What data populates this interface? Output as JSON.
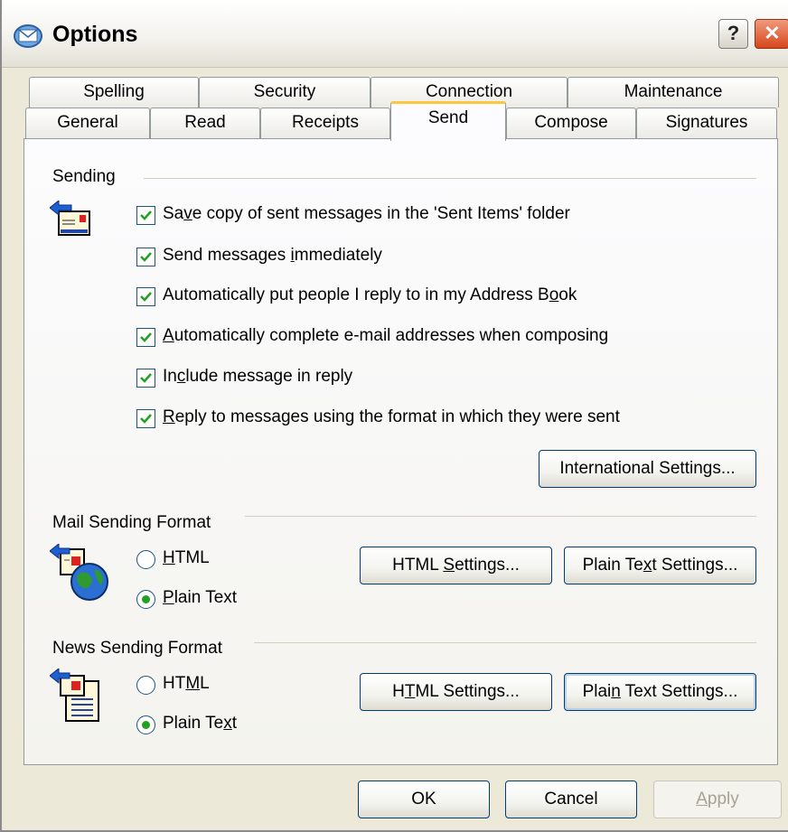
{
  "window": {
    "title": "Options",
    "help_label": "?",
    "close_label": "✕"
  },
  "tabs_row1": [
    {
      "label": "Spelling"
    },
    {
      "label": "Security"
    },
    {
      "label": "Connection"
    },
    {
      "label": "Maintenance"
    }
  ],
  "tabs_row2": [
    {
      "label": "General"
    },
    {
      "label": "Read"
    },
    {
      "label": "Receipts"
    },
    {
      "label": "Send",
      "active": true
    },
    {
      "label": "Compose"
    },
    {
      "label": "Signatures"
    }
  ],
  "sending": {
    "heading": "Sending",
    "icon": "outbox-mail-icon",
    "options": [
      {
        "pre": "Sa",
        "ul": "v",
        "post": "e copy of sent messages in the 'Sent Items' folder",
        "checked": true
      },
      {
        "pre": "Send messages ",
        "ul": "i",
        "post": "mmediately",
        "checked": true
      },
      {
        "pre": "Automatically put people I reply to in my Address B",
        "ul": "o",
        "post": "ok",
        "checked": true
      },
      {
        "pre": "",
        "ul": "A",
        "post": "utomatically complete e-mail addresses when composing",
        "checked": true
      },
      {
        "pre": "In",
        "ul": "c",
        "post": "lude message in reply",
        "checked": true
      },
      {
        "pre": "",
        "ul": "R",
        "post": "eply to messages using the format in which they were sent",
        "checked": true
      }
    ],
    "intl_button": "International Settings..."
  },
  "mail_format": {
    "heading": "Mail Sending Format",
    "icon": "mail-globe-icon",
    "html_radio": {
      "pre": "",
      "ul": "H",
      "post": "TML",
      "selected": false
    },
    "plain_radio": {
      "pre": "",
      "ul": "P",
      "post": "lain Text",
      "selected": true
    },
    "html_settings": {
      "pre": "HTML ",
      "ul": "S",
      "post": "ettings..."
    },
    "plain_settings": {
      "pre": "Plain Te",
      "ul": "x",
      "post": "t Settings..."
    }
  },
  "news_format": {
    "heading": "News Sending Format",
    "icon": "news-document-icon",
    "html_radio": {
      "pre": "HT",
      "ul": "M",
      "post": "L",
      "selected": false
    },
    "plain_radio": {
      "pre": "Plain Te",
      "ul": "x",
      "post": "t",
      "selected": true
    },
    "html_settings": {
      "pre": "H",
      "ul": "T",
      "post": "ML Settings..."
    },
    "plain_settings": {
      "pre": "Plai",
      "ul": "n",
      "post": " Text Settings..."
    }
  },
  "footer": {
    "ok": "OK",
    "cancel": "Cancel",
    "apply": "Apply",
    "apply_ul": "A",
    "apply_post": "pply"
  }
}
